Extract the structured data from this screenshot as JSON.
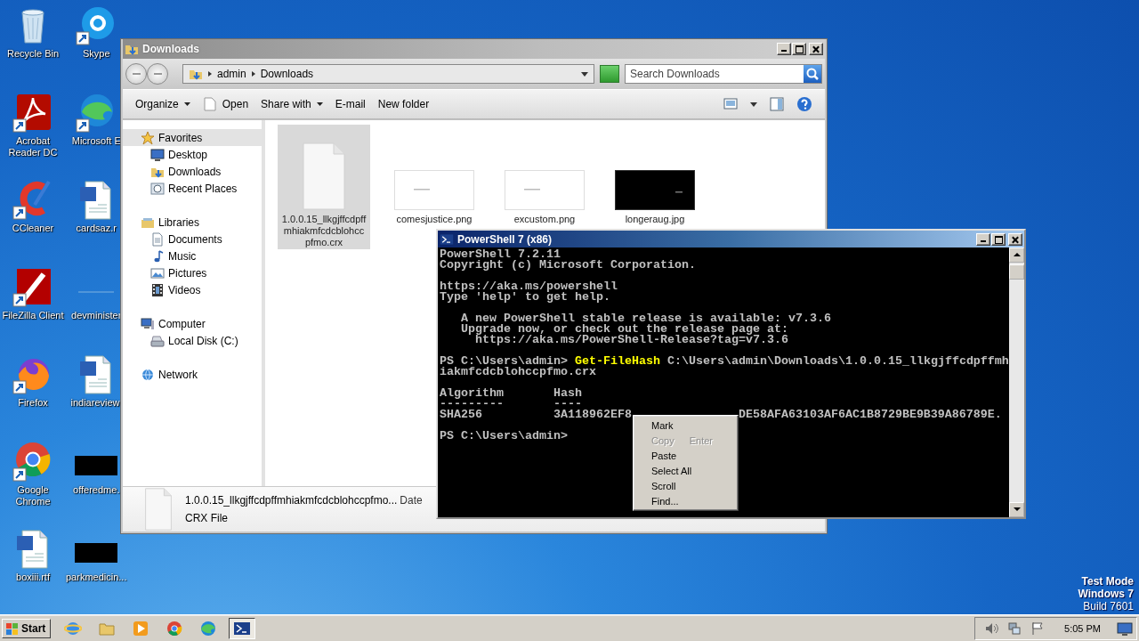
{
  "desktop": {
    "icon_columns": [
      [
        {
          "label": "Recycle Bin",
          "kind": "recycle",
          "shortcut": false
        },
        {
          "label": "Acrobat Reader DC",
          "kind": "acrobat",
          "shortcut": true
        },
        {
          "label": "CCleaner",
          "kind": "ccleaner",
          "shortcut": true
        },
        {
          "label": "FileZilla Client",
          "kind": "filezilla",
          "shortcut": true
        },
        {
          "label": "Firefox",
          "kind": "firefox",
          "shortcut": true
        },
        {
          "label": "Google Chrome",
          "kind": "chrome",
          "shortcut": true
        },
        {
          "label": "boxiii.rtf",
          "kind": "word",
          "shortcut": false
        }
      ],
      [
        {
          "label": "Skype",
          "kind": "skype",
          "shortcut": true
        },
        {
          "label": "Microsoft E",
          "kind": "edge",
          "shortcut": true
        },
        {
          "label": "cardsaz.r",
          "kind": "word",
          "shortcut": false
        },
        {
          "label": "devminister",
          "kind": "blank",
          "shortcut": false
        },
        {
          "label": "indiareview.",
          "kind": "word",
          "shortcut": false
        },
        {
          "label": "offeredme.",
          "kind": "dark",
          "shortcut": false
        },
        {
          "label": "parkmedicin...",
          "kind": "dark",
          "shortcut": false
        }
      ]
    ],
    "edition": {
      "mode": "Test Mode",
      "os": "Windows 7",
      "build": "Build 7601"
    }
  },
  "explorer": {
    "title": "Downloads",
    "path": [
      "admin",
      "Downloads"
    ],
    "search": {
      "placeholder": "Search Downloads"
    },
    "toolbar": [
      {
        "label": "Organize",
        "kind": "menu"
      },
      {
        "label": "Open",
        "kind": "icon"
      },
      {
        "label": "Share with",
        "kind": "menu"
      },
      {
        "label": "E-mail",
        "kind": "plain"
      },
      {
        "label": "New folder",
        "kind": "plain"
      }
    ],
    "nav": [
      {
        "label": "Favorites",
        "kind": "star",
        "selected": true,
        "children": [
          {
            "label": "Desktop",
            "kind": "desktop",
            "selected": false
          },
          {
            "label": "Downloads",
            "kind": "downloads",
            "selected": false
          },
          {
            "label": "Recent Places",
            "kind": "recent",
            "selected": false
          }
        ]
      },
      {
        "label": "Libraries",
        "kind": "library",
        "selected": false,
        "children": [
          {
            "label": "Documents",
            "kind": "documents",
            "selected": false
          },
          {
            "label": "Music",
            "kind": "music",
            "selected": false
          },
          {
            "label": "Pictures",
            "kind": "pictures",
            "selected": false
          },
          {
            "label": "Videos",
            "kind": "videos",
            "selected": false
          }
        ]
      },
      {
        "label": "Computer",
        "kind": "computer",
        "selected": false,
        "children": [
          {
            "label": "Local Disk (C:)",
            "kind": "disk",
            "selected": false
          }
        ]
      },
      {
        "label": "Network",
        "kind": "network",
        "selected": false
      }
    ],
    "files": [
      {
        "name": "1.0.0.15_llkgjffcdpffmhiakmfcdcblohccpfmo.crx",
        "kind": "document",
        "selected": true
      },
      {
        "name": "comesjustice.png",
        "kind": "light-image",
        "selected": false
      },
      {
        "name": "excustom.png",
        "kind": "light-image",
        "selected": false
      },
      {
        "name": "longeraug.jpg",
        "kind": "dark-image",
        "selected": false
      }
    ],
    "details": {
      "name": "1.0.0.15_llkgjffcdpffmhiakmfcdcblohccpfmo...",
      "field": "Date",
      "type": "CRX File"
    }
  },
  "console": {
    "title": "PowerShell 7 (x86)",
    "blocks": [
      {
        "kind": "text",
        "lines": [
          "PowerShell 7.2.11",
          "Copyright (c) Microsoft Corporation."
        ]
      },
      {
        "kind": "text",
        "lines": [
          "https://aka.ms/powershell",
          "Type 'help' to get help."
        ]
      },
      {
        "kind": "text",
        "lines": [
          "   A new PowerShell stable release is available: v7.3.6",
          "   Upgrade now, or check out the release page at:",
          "     https://aka.ms/PowerShell-Release?tag=v7.3.6"
        ]
      },
      {
        "kind": "command",
        "prompt": "PS C:\\Users\\admin> ",
        "command": "Get-FileHash",
        "argument": " C:\\Users\\admin\\Downloads\\1.0.0.15_llkgjffcdpffmhiakmfcdcblohccpfmo.crx"
      },
      {
        "kind": "table",
        "columns": [
          "Algorithm",
          "Hash"
        ],
        "rules": [
          "---------",
          "----"
        ],
        "rows": [
          {
            "algorithm": "SHA256",
            "hash": [
              "3A118962EF8",
              "DE58AFA63103AF6AC1B8729BE9B39A86789E."
            ]
          }
        ]
      },
      {
        "kind": "prompt",
        "text": "PS C:\\Users\\admin>"
      }
    ],
    "menu": [
      {
        "label": "Mark",
        "disabled": false
      },
      {
        "label": "Copy",
        "shortcut": "Enter",
        "disabled": true
      },
      {
        "label": "Paste",
        "disabled": false
      },
      {
        "label": "Select All",
        "disabled": false
      },
      {
        "label": "Scroll",
        "disabled": false
      },
      {
        "label": "Find...",
        "disabled": false
      }
    ]
  },
  "taskbar": {
    "start": "Start",
    "apps": [
      {
        "kind": "ie",
        "active": false
      },
      {
        "kind": "folder",
        "active": false
      },
      {
        "kind": "media",
        "active": false
      },
      {
        "kind": "chrome",
        "active": false
      },
      {
        "kind": "edge",
        "active": false
      },
      {
        "kind": "powershell",
        "active": true
      }
    ],
    "tray": [
      {
        "kind": "volume"
      },
      {
        "kind": "network"
      },
      {
        "kind": "flag"
      }
    ],
    "clock": "5:05 PM"
  }
}
